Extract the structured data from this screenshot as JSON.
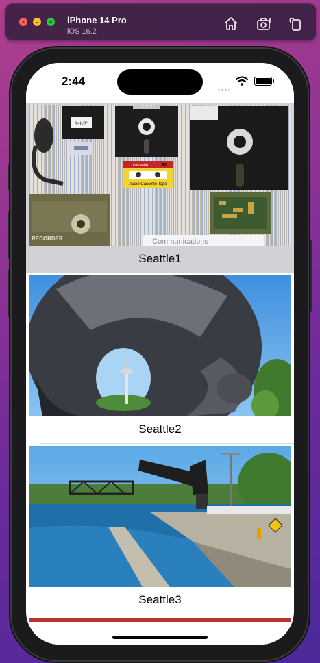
{
  "simulator": {
    "device_name": "iPhone 14 Pro",
    "os_version": "iOS 16.2",
    "toolbar_buttons": [
      "home-icon",
      "screenshot-icon",
      "rotate-icon"
    ]
  },
  "status_bar": {
    "time": "2:44"
  },
  "list": {
    "items": [
      {
        "title": "Seattle1",
        "selected": true,
        "image_overlay_text": "Communications"
      },
      {
        "title": "Seattle2",
        "selected": false
      },
      {
        "title": "Seattle3",
        "selected": false
      }
    ]
  },
  "photo1": {
    "disk_label": "3-1/2\"",
    "cassette_brand": "cassette",
    "cassette_number": "60",
    "cassette_caption": "Audio Cassette Tape",
    "recorder_text": "RECORDER"
  },
  "colors": {
    "accent_selected_row": "#d1d1d6",
    "sky": "#5aa9e6",
    "water": "#1f6fa8"
  }
}
